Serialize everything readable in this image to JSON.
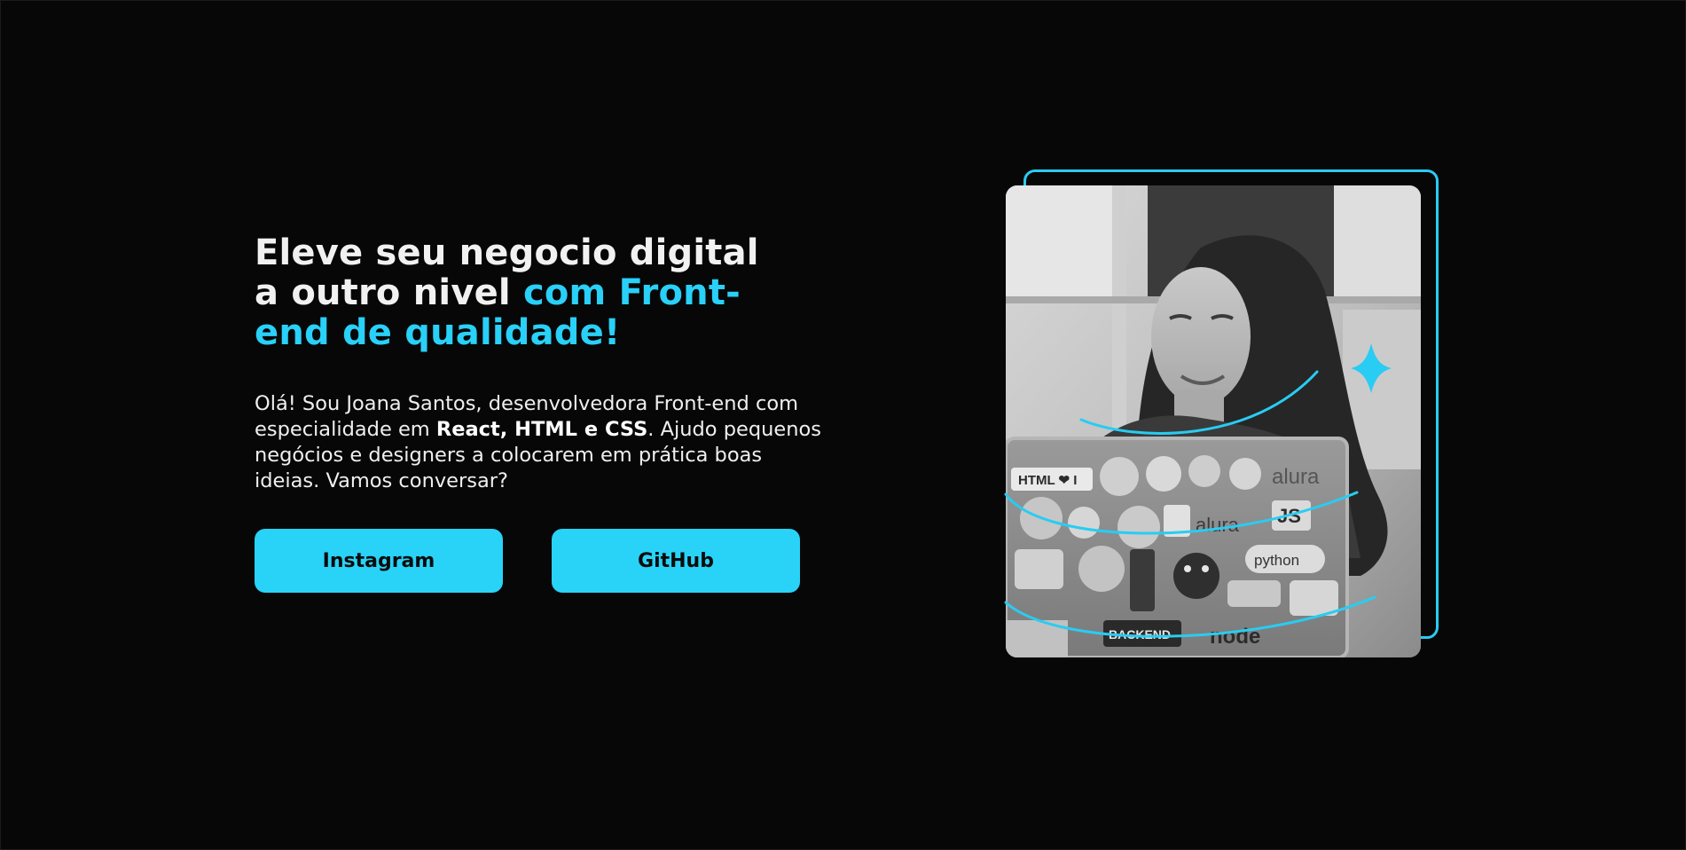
{
  "hero": {
    "title_line1": "Eleve seu negocio digital",
    "title_line2_plain": "a outro nivel ",
    "title_line2_accent": "com Front-",
    "title_line3_accent": "end de qualidade!",
    "description_intro": "Olá! Sou Joana Santos, desenvolvedora Front-end com especialidade em ",
    "description_bold": "React, HTML e CSS",
    "description_outro": ". Ajudo pequenos negócios e designers a colocarem em prática boas ideias. Vamos conversar?"
  },
  "buttons": {
    "instagram_label": "Instagram",
    "github_label": "GitHub"
  },
  "image": {
    "subject": "black-and-white photo of a smiling woman behind a laptop covered in tech stickers",
    "sticker_texts": [
      "HTML ❤ I",
      "alura",
      "JS",
      "alura",
      "python",
      "BACKEND",
      "node"
    ]
  },
  "colors": {
    "background": "#070708",
    "accent": "#29d0f7",
    "button": "#29d3f8",
    "button_text": "#0c0c0c",
    "text": "#f1f1f1"
  },
  "icons": {
    "sparkle": "sparkle-star-icon"
  }
}
